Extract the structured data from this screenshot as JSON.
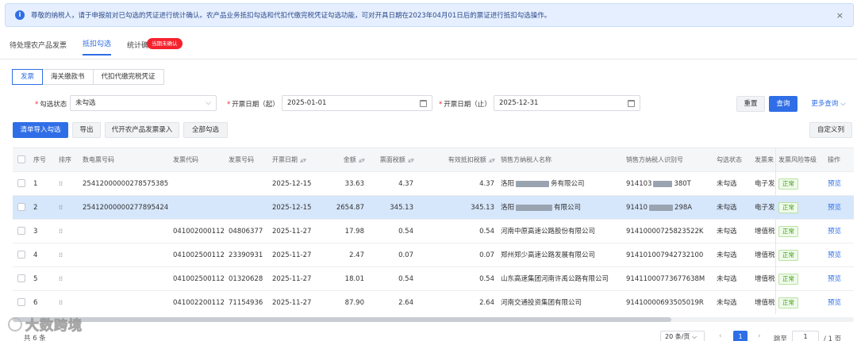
{
  "notice": {
    "text": "尊敬的纳税人，请于申报前对已勾选的凭证进行统计确认。农产品业务抵扣勾选和代扣代缴完税凭证勾选功能，可对开具日期在2023年04月01日后的票证进行抵扣勾选操作。",
    "close": "×"
  },
  "tabs": [
    {
      "label": "待处理农产品发票"
    },
    {
      "label": "抵扣勾选"
    },
    {
      "label": "统计确认"
    }
  ],
  "tab_badge": "当期未确认",
  "sub_tabs": [
    {
      "label": "发票"
    },
    {
      "label": "海关缴款书"
    },
    {
      "label": "代扣代缴完税凭证"
    }
  ],
  "filters": {
    "status_label": "勾选状态",
    "status_value": "未勾选",
    "start_label": "开票日期（起）",
    "start_value": "2025-01-01",
    "end_label": "开票日期（止）",
    "end_value": "2025-12-31",
    "required_mark": "*"
  },
  "actions": {
    "reset": "重置",
    "search": "查询",
    "more": "更多查询",
    "import": "清单导入勾选",
    "export": "导出",
    "agri_entry": "代开农产品发票录入",
    "select_all": "全部勾选",
    "custom_columns": "自定义列"
  },
  "table": {
    "headers": [
      "序号",
      "排序",
      "数电票号码",
      "发票代码",
      "发票号码",
      "开票日期",
      "金额",
      "票面税额",
      "有效抵扣税额",
      "销售方纳税人名称",
      "销售方纳税人识别号",
      "勾选状态",
      "发票来",
      "发票风险等级",
      "操作"
    ],
    "rows": [
      {
        "no": "1",
        "einv": "25412000000278575385",
        "code": "",
        "num": "",
        "date": "2025-12-15",
        "amount": "33.63",
        "tax": "4.37",
        "eff_tax": "4.37",
        "seller_a": "洛阳",
        "seller_b": "务有限公司",
        "taxid_a": "914103",
        "taxid_b": "380T",
        "status": "未勾选",
        "source": "电子发",
        "risk": "正常",
        "op": "预览"
      },
      {
        "no": "2",
        "einv": "25412000000277895424",
        "code": "",
        "num": "",
        "date": "2025-12-15",
        "amount": "2654.87",
        "tax": "345.13",
        "eff_tax": "345.13",
        "seller_a": "洛阳",
        "seller_b": "有限公司",
        "taxid_a": "91410",
        "taxid_b": "298A",
        "status": "未勾选",
        "source": "电子发",
        "risk": "正常",
        "op": "预览"
      },
      {
        "no": "3",
        "einv": "",
        "code": "041002000112",
        "num": "04806377",
        "date": "2025-11-27",
        "amount": "17.98",
        "tax": "0.54",
        "eff_tax": "0.54",
        "seller": "河南中原高速公路股份有限公司",
        "taxid": "91410000725823522K",
        "status": "未勾选",
        "source": "增值税",
        "risk": "正常",
        "op": "预览"
      },
      {
        "no": "4",
        "einv": "",
        "code": "041002500112",
        "num": "23390931",
        "date": "2025-11-27",
        "amount": "2.47",
        "tax": "0.07",
        "eff_tax": "0.07",
        "seller": "郑州郑少高速公路发展有限公司",
        "taxid": "914101007942732100",
        "status": "未勾选",
        "source": "增值税",
        "risk": "正常",
        "op": "预览"
      },
      {
        "no": "5",
        "einv": "",
        "code": "041002500112",
        "num": "01320628",
        "date": "2025-11-27",
        "amount": "18.01",
        "tax": "0.54",
        "eff_tax": "0.54",
        "seller": "山东高速集团河南许禹公路有限公司",
        "taxid": "91411000773677638M",
        "status": "未勾选",
        "source": "增值税",
        "risk": "正常",
        "op": "预览"
      },
      {
        "no": "6",
        "einv": "",
        "code": "041002200112",
        "num": "71154936",
        "date": "2025-11-27",
        "amount": "87.90",
        "tax": "2.64",
        "eff_tax": "2.64",
        "seller": "河南交通投资集团有限公司",
        "taxid": "91410000693505019R",
        "status": "未勾选",
        "source": "增值税",
        "risk": "正常",
        "op": "预览"
      }
    ]
  },
  "footer": {
    "total": "共 6 条",
    "page_size": "20 条/页",
    "page": "1",
    "goto_label": "跳至",
    "goto_value": "1",
    "pages": "/ 1 页"
  },
  "watermark": {
    "text": "大数跨境"
  },
  "icons": {
    "info": "info-icon",
    "calendar": "calendar-icon",
    "chevron": "chevron-down-icon",
    "sort": "sort-icon",
    "drag": "drag-handle-icon"
  },
  "colors": {
    "primary": "#2f6ee6",
    "badge": "#f5222d",
    "selected_row": "#d6e6fb",
    "ok_tag": "#389e0d"
  }
}
